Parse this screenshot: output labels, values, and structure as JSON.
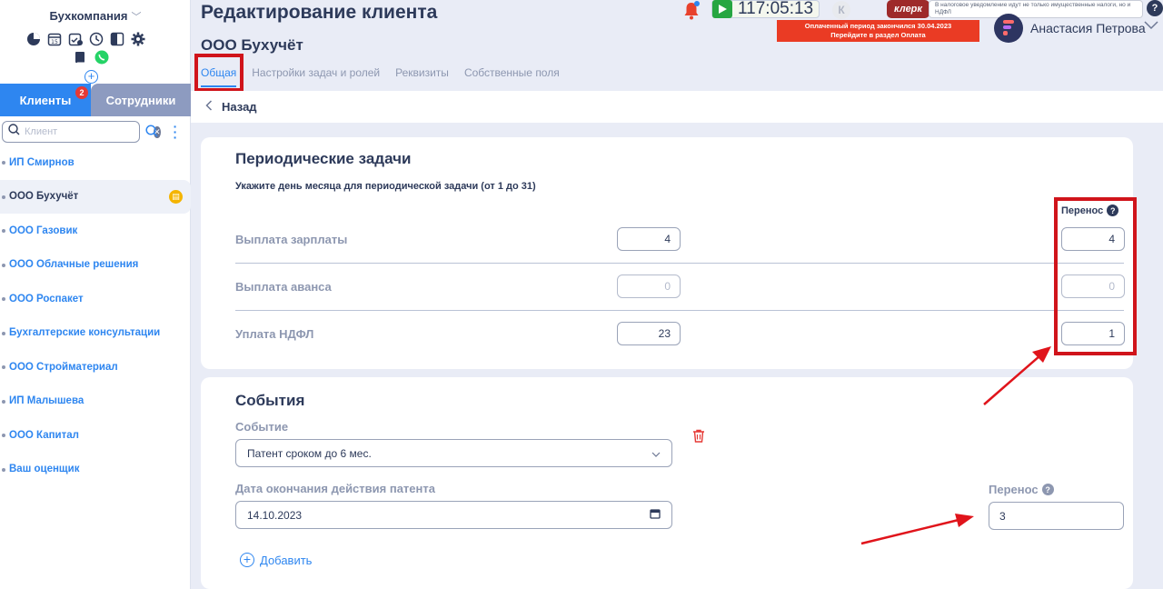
{
  "sidebar": {
    "company": "Бухкомпания",
    "tabs": {
      "clients": "Клиенты",
      "clients_badge": "2",
      "staff": "Сотрудники"
    },
    "search": {
      "placeholder": "Клиент"
    },
    "clients": [
      {
        "name": "ИП Смирнов"
      },
      {
        "name": "ООО Бухучёт",
        "active": true
      },
      {
        "name": "ООО Газовик"
      },
      {
        "name": "ООО Облачные решения"
      },
      {
        "name": "ООО Роспакет"
      },
      {
        "name": "Бухгалтерские консультации"
      },
      {
        "name": "ООО Стройматериал"
      },
      {
        "name": "ИП Малышева"
      },
      {
        "name": "ООО Капитал"
      },
      {
        "name": "Ваш оценщик"
      }
    ]
  },
  "header": {
    "title": "Редактирование клиента",
    "client_name": "ООО Бухучёт",
    "timer": "117:05:13",
    "klerk": "клерк",
    "notice": "В налоговое уведомление идут не только имущественные налоги, но и НДФЛ",
    "payment_banner_line1": "Оплаченный период закончился 30.04.2023",
    "payment_banner_line2": "Перейдите в раздел Оплата",
    "user": "Анастасия Петрова",
    "k_letter": "К",
    "help": "?"
  },
  "main_tabs": [
    "Общая",
    "Настройки задач и ролей",
    "Реквизиты",
    "Собственные поля"
  ],
  "back_label": "Назад",
  "periodic": {
    "title": "Периодические задачи",
    "subtitle": "Укажите день месяца для периодической задачи (от 1 до 31)",
    "perenos_header": "Перенос",
    "rows": [
      {
        "label": "Выплата зарплаты",
        "day": "4",
        "perenos": "4"
      },
      {
        "label": "Выплата аванса",
        "day": "0",
        "perenos": "0"
      },
      {
        "label": "Уплата НДФЛ",
        "day": "23",
        "perenos": "1"
      }
    ]
  },
  "events": {
    "title": "События",
    "event_label": "Событие",
    "event_value": "Патент сроком до 6 мес.",
    "date_label": "Дата окончания действия патента",
    "date_value": "14.10.2023",
    "perenos_label": "Перенос",
    "perenos_value": "3",
    "add_label": "Добавить"
  },
  "colors": {
    "accent": "#2e86f0",
    "highlight": "#d0141b",
    "banner": "#ea3b24"
  }
}
